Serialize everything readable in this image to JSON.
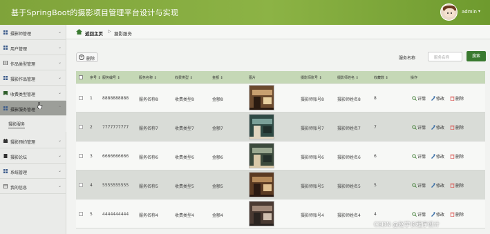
{
  "app": {
    "title": "基于SpringBoot的摄影项目管理平台设计与实现",
    "user": "admin",
    "caret": "▾"
  },
  "sidebar": {
    "items": [
      {
        "label": "摄影师管理",
        "icon": "grid-icon"
      },
      {
        "label": "用户管理",
        "icon": "grid-icon"
      },
      {
        "label": "作品类型管理",
        "icon": "document-icon"
      },
      {
        "label": "摄影作品管理",
        "icon": "grid-icon"
      },
      {
        "label": "收费类型管理",
        "icon": "tag-icon"
      },
      {
        "label": "摄影服务管理",
        "icon": "grid-icon"
      },
      {
        "label": "摄影预约管理",
        "icon": "calendar-icon"
      },
      {
        "label": "摄影论坛",
        "icon": "document-icon"
      },
      {
        "label": "系统管理",
        "icon": "grid-icon"
      },
      {
        "label": "我的信息",
        "icon": "window-icon"
      }
    ],
    "sub_item": "摄影服务",
    "chevron": "⌄"
  },
  "breadcrumb": {
    "home": "返回主页",
    "sep": "▷",
    "current": "摄影服务"
  },
  "toolbar": {
    "delete_label": "删除",
    "search_label": "服务名称",
    "search_placeholder": "服务名称",
    "search_button": "搜索"
  },
  "table": {
    "headers": [
      "序号",
      "服务编号",
      "服务名称",
      "收费类型",
      "金额",
      "图片",
      "摄影师账号",
      "摄影师姓名",
      "收藏数",
      "操作"
    ],
    "sort_mark": "⇕",
    "rows": [
      {
        "no": "1",
        "code": "8888888888",
        "name": "服务名称8",
        "type": "收费类型8",
        "amount": "金额8",
        "account": "摄影师账号8",
        "pname": "摄影师姓名8",
        "fav": "8"
      },
      {
        "no": "2",
        "code": "7777777777",
        "name": "服务名称7",
        "type": "收费类型7",
        "amount": "金额7",
        "account": "摄影师账号7",
        "pname": "摄影师姓名7",
        "fav": "7"
      },
      {
        "no": "3",
        "code": "6666666666",
        "name": "服务名称6",
        "type": "收费类型6",
        "amount": "金额6",
        "account": "摄影师账号6",
        "pname": "摄影师姓名6",
        "fav": "6"
      },
      {
        "no": "4",
        "code": "5555555555",
        "name": "服务名称5",
        "type": "收费类型5",
        "amount": "金额5",
        "account": "摄影师账号5",
        "pname": "摄影师姓名5",
        "fav": "5"
      },
      {
        "no": "5",
        "code": "4444444444",
        "name": "服务名称4",
        "type": "收费类型4",
        "amount": "金额4",
        "account": "摄影师账号4",
        "pname": "摄影师姓名4",
        "fav": "4"
      }
    ],
    "actions": {
      "detail": "详情",
      "edit": "修改",
      "delete": "删除"
    }
  },
  "watermark": "CSDN @赵学长程序设计",
  "colors": {
    "topbar": "#8cb345",
    "accent": "#3a7a30",
    "table_header": "#c5d8b6",
    "delete_icon": "#d9534f"
  }
}
